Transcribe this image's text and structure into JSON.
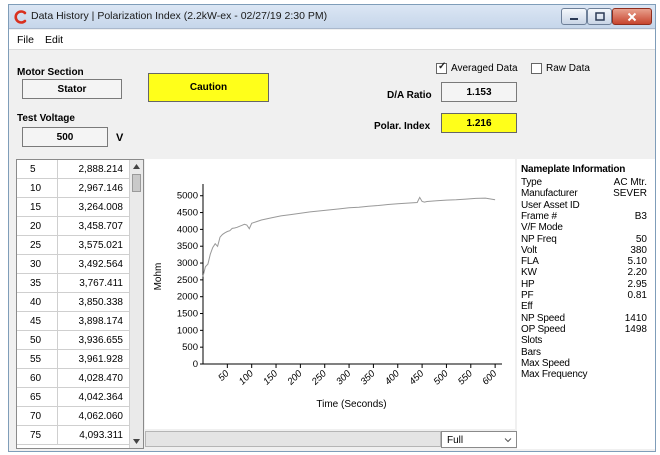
{
  "window": {
    "title": "Data History | Polarization Index (2.2kW-ex - 02/27/19 2:30 PM)"
  },
  "menu": {
    "file": "File",
    "edit": "Edit"
  },
  "motor_section": {
    "label": "Motor Section",
    "value": "Stator"
  },
  "status": {
    "value": "Caution",
    "color": "#ffff1a"
  },
  "test_voltage": {
    "label": "Test Voltage",
    "value": "500",
    "unit": "V"
  },
  "options": {
    "averaged_label": "Averaged Data",
    "averaged_checked": true,
    "raw_label": "Raw Data",
    "raw_checked": false
  },
  "da_ratio": {
    "label": "D/A Ratio",
    "value": "1.153"
  },
  "polar_index": {
    "label": "Polar. Index",
    "value": "1.216"
  },
  "readings": [
    {
      "time": "5",
      "value": "2,888.214"
    },
    {
      "time": "10",
      "value": "2,967.146"
    },
    {
      "time": "15",
      "value": "3,264.008"
    },
    {
      "time": "20",
      "value": "3,458.707"
    },
    {
      "time": "25",
      "value": "3,575.021"
    },
    {
      "time": "30",
      "value": "3,492.564"
    },
    {
      "time": "35",
      "value": "3,767.411"
    },
    {
      "time": "40",
      "value": "3,850.338"
    },
    {
      "time": "45",
      "value": "3,898.174"
    },
    {
      "time": "50",
      "value": "3,936.655"
    },
    {
      "time": "55",
      "value": "3,961.928"
    },
    {
      "time": "60",
      "value": "4,028.470"
    },
    {
      "time": "65",
      "value": "4,042.364"
    },
    {
      "time": "70",
      "value": "4,062.060"
    },
    {
      "time": "75",
      "value": "4,093.311"
    }
  ],
  "chart_data": {
    "type": "line",
    "xlabel": "Time (Seconds)",
    "ylabel": "Mohm",
    "xlim": [
      0,
      610
    ],
    "ylim": [
      0,
      5200
    ],
    "xticks": [
      50,
      100,
      150,
      200,
      250,
      300,
      350,
      400,
      450,
      500,
      550,
      600
    ],
    "yticks": [
      0,
      500,
      1000,
      1500,
      2000,
      2500,
      3000,
      3500,
      4000,
      4500,
      5000
    ],
    "grid": false,
    "line_color": "#999999",
    "series": [
      {
        "x": [
          0,
          5,
          10,
          15,
          20,
          25,
          30,
          35,
          40,
          45,
          50,
          55,
          60,
          65,
          70,
          75,
          80,
          85,
          90,
          95,
          100,
          110,
          120,
          140,
          160,
          180,
          200,
          220,
          240,
          260,
          280,
          300,
          320,
          340,
          360,
          380,
          400,
          420,
          440,
          445,
          450,
          455,
          460,
          480,
          500,
          520,
          540,
          560,
          580,
          600
        ],
        "y": [
          2600,
          2888,
          2967,
          3264,
          3459,
          3575,
          3493,
          3767,
          3850,
          3898,
          3937,
          3962,
          4028,
          4042,
          4062,
          4093,
          4120,
          4150,
          4130,
          4020,
          4180,
          4230,
          4280,
          4340,
          4400,
          4440,
          4480,
          4520,
          4550,
          4580,
          4610,
          4640,
          4660,
          4690,
          4710,
          4740,
          4760,
          4780,
          4800,
          4950,
          4830,
          4810,
          4830,
          4850,
          4870,
          4880,
          4900,
          4920,
          4930,
          4880
        ]
      }
    ]
  },
  "zoom": {
    "value": "Full"
  },
  "nameplate": {
    "title": "Nameplate Information",
    "rows": [
      {
        "k": "Type",
        "v": "AC Mtr."
      },
      {
        "k": "Manufacturer",
        "v": "SEVER"
      },
      {
        "k": "User Asset ID",
        "v": ""
      },
      {
        "k": "Frame #",
        "v": "B3"
      },
      {
        "k": "V/F Mode",
        "v": ""
      },
      {
        "k": "NP Freq",
        "v": "50"
      },
      {
        "k": "Volt",
        "v": "380"
      },
      {
        "k": "FLA",
        "v": "5.10"
      },
      {
        "k": "KW",
        "v": "2.20"
      },
      {
        "k": "HP",
        "v": "2.95"
      },
      {
        "k": "PF",
        "v": "0.81"
      },
      {
        "k": "Eff",
        "v": ""
      },
      {
        "k": "NP Speed",
        "v": "1410"
      },
      {
        "k": "OP Speed",
        "v": "1498"
      },
      {
        "k": "Slots",
        "v": ""
      },
      {
        "k": "Bars",
        "v": ""
      },
      {
        "k": "Max Speed",
        "v": ""
      },
      {
        "k": "Max Frequency",
        "v": ""
      }
    ]
  }
}
